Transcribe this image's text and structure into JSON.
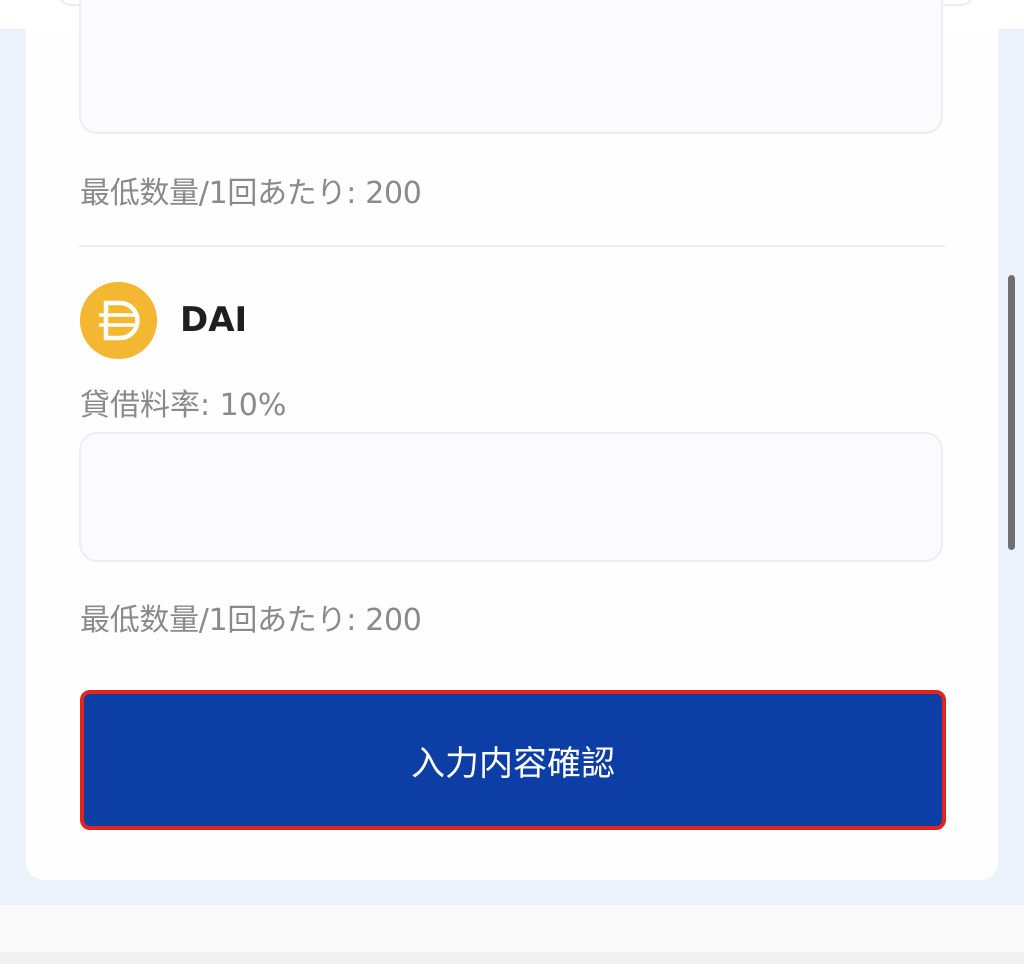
{
  "tokens": [
    {
      "min_quantity_label": "最低数量/1回あたり: 200"
    },
    {
      "icon": "dai-coin-icon",
      "name": "DAI",
      "rate_label": "貸借料率: 10%",
      "min_quantity_label": "最低数量/1回あたり: 200"
    }
  ],
  "confirm_button_label": "入力内容確認",
  "colors": {
    "button_bg": "#0d3ea5",
    "highlight_border": "#e3241b",
    "dai_icon": "#f4b731",
    "page_bg": "#edf3fc"
  }
}
